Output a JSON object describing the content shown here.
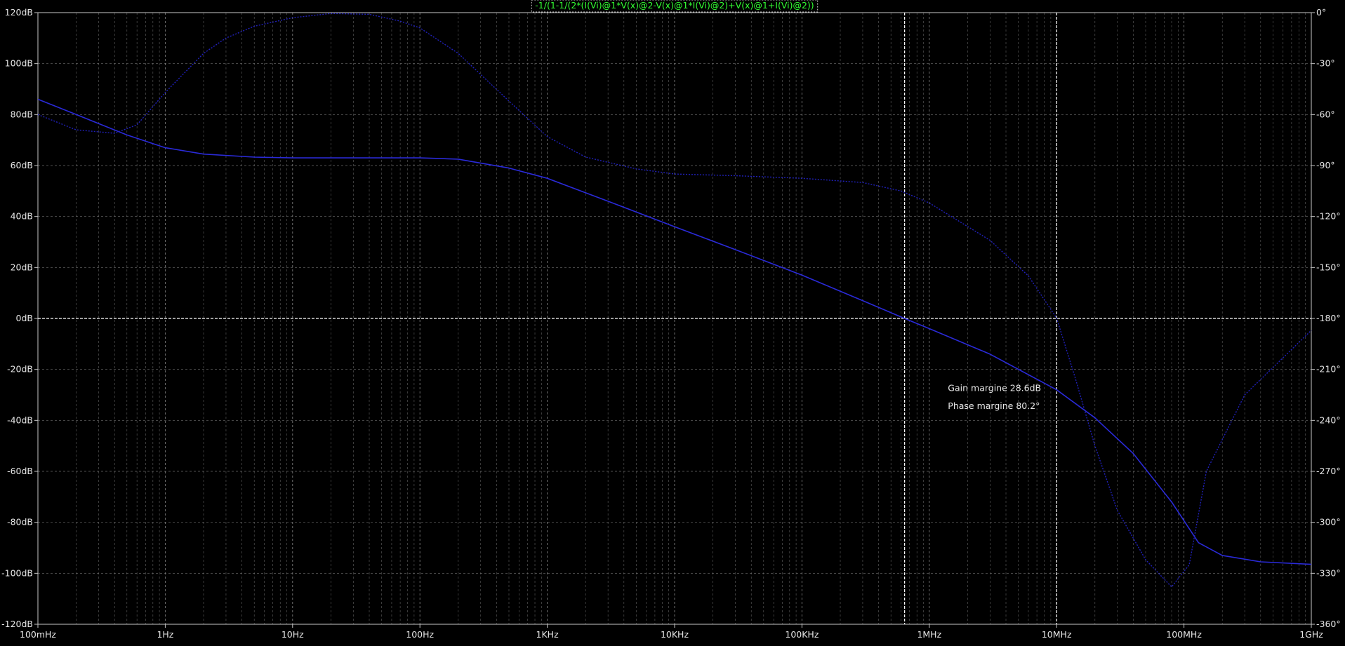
{
  "chart_data": {
    "type": "line",
    "title": "-1/(1-1/(2*(I(Vi)@1*V(x)@2-V(x)@1*I(Vi)@2)+V(x)@1+I(Vi)@2))",
    "x_scale": "log",
    "xlim": [
      0.1,
      1000000000
    ],
    "x_tick_labels": [
      "100mHz",
      "1Hz",
      "10Hz",
      "100Hz",
      "1KHz",
      "10KHz",
      "100KHz",
      "1MHz",
      "10MHz",
      "100MHz",
      "1GHz"
    ],
    "ylim_left": [
      -120,
      120
    ],
    "y_left_tick_labels": [
      "120dB",
      "100dB",
      "80dB",
      "60dB",
      "40dB",
      "20dB",
      "0dB",
      "-20dB",
      "-40dB",
      "-60dB",
      "-80dB",
      "-100dB",
      "-120dB"
    ],
    "ylim_right": [
      -360,
      0
    ],
    "y_right_tick_labels": [
      "0°",
      "-30°",
      "-60°",
      "-90°",
      "-120°",
      "-150°",
      "-180°",
      "-210°",
      "-240°",
      "-270°",
      "-300°",
      "-330°",
      "-360°"
    ],
    "grid": true,
    "series": [
      {
        "axis": "left",
        "style": "solid",
        "color": "#2a2ad8",
        "points": [
          [
            0.1,
            86
          ],
          [
            0.2,
            80
          ],
          [
            0.5,
            72
          ],
          [
            1,
            67
          ],
          [
            2,
            64.5
          ],
          [
            5,
            63.3
          ],
          [
            10,
            63
          ],
          [
            30,
            63
          ],
          [
            100,
            63
          ],
          [
            200,
            62.5
          ],
          [
            500,
            59
          ],
          [
            1000,
            55
          ],
          [
            3000,
            46
          ],
          [
            10000,
            36
          ],
          [
            30000,
            27
          ],
          [
            100000,
            17
          ],
          [
            300000,
            7
          ],
          [
            640000,
            0
          ],
          [
            1000000,
            -4
          ],
          [
            3000000,
            -14
          ],
          [
            10000000,
            -28
          ],
          [
            20000000,
            -39
          ],
          [
            40000000,
            -53
          ],
          [
            80000000,
            -72
          ],
          [
            130000000,
            -88
          ],
          [
            200000000,
            -93
          ],
          [
            400000000,
            -95.5
          ],
          [
            1000000000,
            -96.5
          ]
        ]
      },
      {
        "axis": "right",
        "style": "dashed",
        "color": "#2020b8",
        "points": [
          [
            0.1,
            -60
          ],
          [
            0.2,
            -69
          ],
          [
            0.4,
            -71
          ],
          [
            0.6,
            -66
          ],
          [
            1,
            -47
          ],
          [
            2,
            -24
          ],
          [
            3,
            -15
          ],
          [
            5,
            -8
          ],
          [
            10,
            -3
          ],
          [
            20,
            -0.5
          ],
          [
            40,
            -1
          ],
          [
            70,
            -5
          ],
          [
            100,
            -9
          ],
          [
            200,
            -24
          ],
          [
            500,
            -52
          ],
          [
            1000,
            -73
          ],
          [
            2000,
            -85
          ],
          [
            5000,
            -92
          ],
          [
            10000,
            -95
          ],
          [
            30000,
            -96
          ],
          [
            100000,
            -97.5
          ],
          [
            300000,
            -100
          ],
          [
            600000,
            -105
          ],
          [
            1000000,
            -112
          ],
          [
            3000000,
            -134
          ],
          [
            6000000,
            -155
          ],
          [
            10000000,
            -179.8
          ],
          [
            14000000,
            -215
          ],
          [
            20000000,
            -255
          ],
          [
            30000000,
            -293
          ],
          [
            50000000,
            -322
          ],
          [
            80000000,
            -338
          ],
          [
            110000000,
            -325
          ],
          [
            150000000,
            -270
          ],
          [
            300000000,
            -225
          ],
          [
            1000000000,
            -187
          ]
        ]
      }
    ],
    "cursors": [
      {
        "x": 640000,
        "orientation": "vertical"
      },
      {
        "x": 10000000,
        "orientation": "vertical"
      }
    ],
    "zero_line": {
      "y": 0
    },
    "annotations": [
      {
        "text": "Gain margine 28.6dB",
        "x": 1400000,
        "y": -28.5
      },
      {
        "text": "Phase margine 80.2°",
        "x": 1400000,
        "y": -35.5
      }
    ],
    "colors": {
      "background": "#000000",
      "axis": "#c8c8c8",
      "grid": "#808080",
      "text": "#e6e6e6",
      "title_bg": "#000000",
      "title_text": "#33ff33",
      "title_border": "#c8c8c8",
      "cursor": "#ffffff"
    }
  }
}
